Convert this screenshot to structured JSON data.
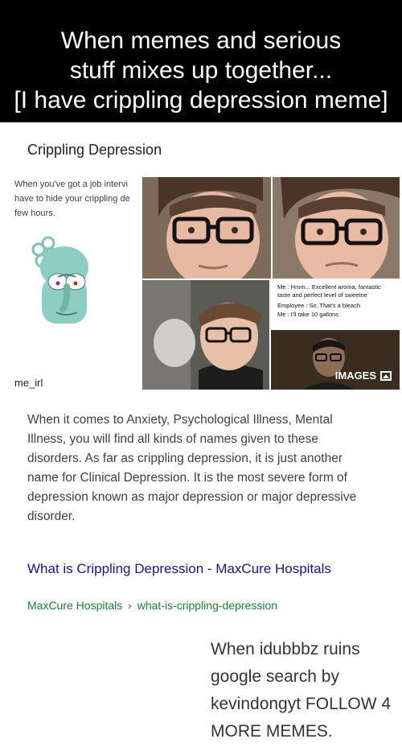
{
  "meme": {
    "caption_lines": [
      "When memes and serious",
      "stuff mixes up together...",
      "[I have crippling depression meme]"
    ],
    "watermark": "When idubbbz ruins google search by kevindongyt FOLLOW 4 MORE MEMES."
  },
  "card": {
    "title": "Crippling Depression",
    "image_text_lines": [
      "When you've got a job intervi",
      "have to hide your crippling de",
      "few hours."
    ],
    "me_irl": "me_irl",
    "chat_lines": [
      "Me    : Hmm... Excellent aroma, fantastic",
      "           taste and perfect level of sweetne",
      "Employee : Sir, That's a bleach",
      "Me    : I'll take 10 gallons"
    ],
    "images_label": "IMAGES",
    "snippet": "When it comes to Anxiety, Psychological Illness, Mental Illness, you will find all kinds of names given to these disorders. As far as crippling depression, it is just another name for Clinical Depression. It is the most severe form of depression known as major depression or major depressive disorder.",
    "result_title": "What is Crippling Depression - MaxCure Hospitals",
    "result_site": "MaxCure Hospitals",
    "result_separator": "›",
    "result_path": "what-is-crippling-depression"
  },
  "colors": {
    "link": "#1a0dab",
    "cite": "#188038",
    "snippet": "#3c4043"
  }
}
